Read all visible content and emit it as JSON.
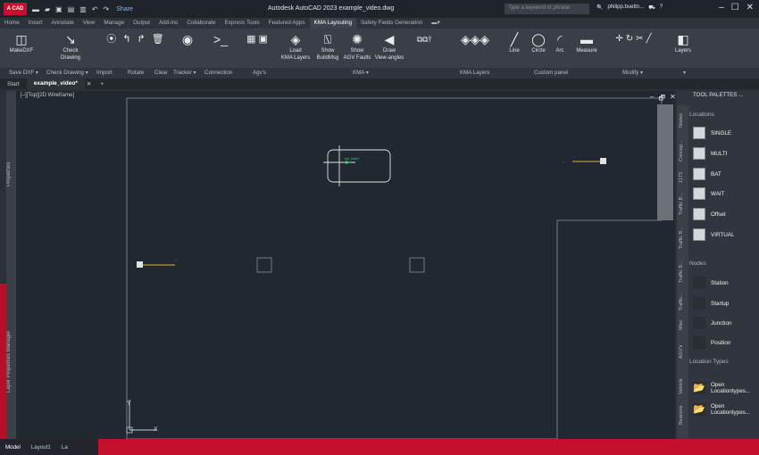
{
  "title_bar": {
    "logo_text": "A CAD",
    "share_label": "Share",
    "window_title": "Autodesk AutoCAD 2023  example_video.dwg",
    "search_placeholder": "Type a keyword or phrase",
    "user_name": "philipp.buettn...",
    "controls": [
      "–",
      "☐",
      "✕"
    ]
  },
  "ribbon_tabs": [
    "Home",
    "Insert",
    "Annotate",
    "View",
    "Manage",
    "Output",
    "Add-ins",
    "Collaborate",
    "Express Tools",
    "Featured Apps",
    "KMA Layouting",
    "Safety Fields Generation",
    "▬▾"
  ],
  "active_ribbon_tab": "KMA Layouting",
  "ribbon_tools": [
    {
      "label": "MakeDXF",
      "icon": "makedxf-icon"
    },
    {
      "label": "Check\nDrawing",
      "icon": "check-drawing-icon"
    },
    {
      "label": "Load\nKMA Layers",
      "icon": "load-layers-icon"
    },
    {
      "label": "Show\nBuildMsg",
      "icon": "show-buildmsg-icon"
    },
    {
      "label": "Show\nAGV Faults",
      "icon": "show-faults-icon"
    },
    {
      "label": "Draw\nView-angles",
      "icon": "draw-viewangles-icon"
    },
    {
      "label": "Line",
      "icon": "line-icon"
    },
    {
      "label": "Circle",
      "icon": "circle-icon"
    },
    {
      "label": "Arc",
      "icon": "arc-icon"
    },
    {
      "label": "Measure",
      "icon": "measure-icon"
    },
    {
      "label": "Layers",
      "icon": "layers-icon"
    }
  ],
  "panel_labels": [
    "Save DXF ▾",
    "Check Drawing ▾",
    "Import",
    "Rotate",
    "Clear",
    "Tracker ▾",
    "Connection",
    "Agv's",
    "KMA ▾",
    "KMA Layers",
    "Custom panel",
    "Modify ▾",
    "▾"
  ],
  "doc_tabs": [
    "Start",
    "example_video*",
    "✕",
    "+"
  ],
  "left_panels": [
    "Properties",
    "Layer Properties Manager"
  ],
  "viewport": {
    "label": "[–][Top][2D Wireframe]",
    "node_label": "sel_label",
    "controls": [
      "–",
      "🗗",
      "✕"
    ]
  },
  "tool_palette": {
    "header": "TOOL PALETTES ...",
    "sections": [
      "Locations",
      "Nodes",
      "Location Types"
    ],
    "location_items": [
      "SINGLE",
      "MULTI",
      "BAT",
      "WAIT",
      "Offset",
      "VIRTUAL"
    ],
    "node_items": [
      "Station",
      "Startup",
      "Junction",
      "Position"
    ],
    "location_type_items": [
      "Open\nLocationtypes...",
      "Open\nLocationtypes..."
    ],
    "side_tabs": [
      "Nodes",
      "Concep...",
      "1173",
      "Traffic B...",
      "Traffic B...",
      "Traffic B...",
      "Traffic...",
      "Misc",
      "AGV's",
      "Vehicle",
      "Beacons"
    ]
  },
  "status_tabs": [
    "Model",
    "Layout1",
    "La"
  ],
  "colors": {
    "accent": "#c8102e",
    "canvas": "#212830",
    "ribbon": "#3a3f47"
  }
}
